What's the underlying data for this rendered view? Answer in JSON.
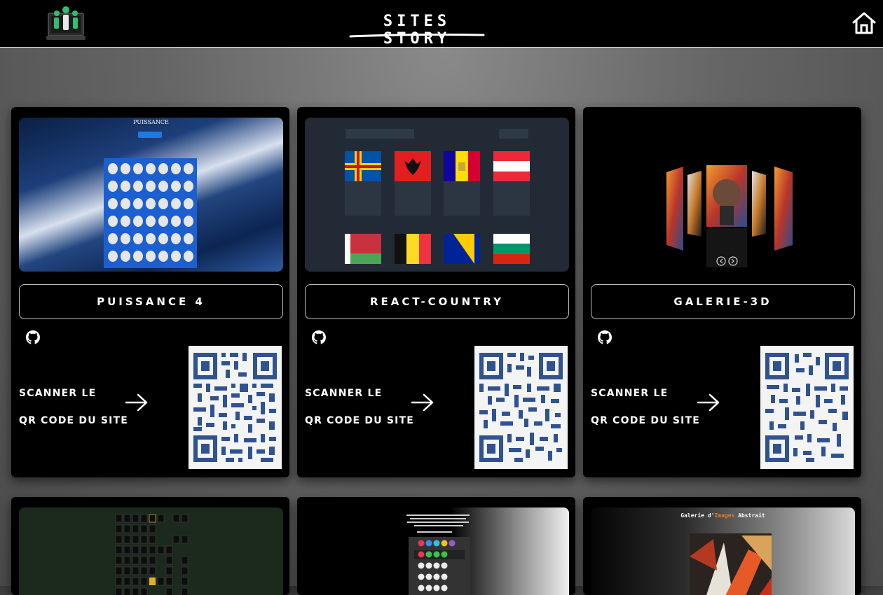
{
  "header": {
    "title": "SITES STORY",
    "logo_icon": "laptop-team-logo",
    "home_icon": "home-icon"
  },
  "projects": [
    {
      "name": "PUISSANCE 4",
      "scan_line1": "SCANNER LE",
      "scan_line2": "QR CODE DU SITE"
    },
    {
      "name": "REACT-COUNTRY",
      "scan_line1": "SCANNER LE",
      "scan_line2": "QR CODE DU SITE"
    },
    {
      "name": "GALERIE-3D",
      "scan_line1": "SCANNER LE",
      "scan_line2": "QR CODE DU SITE"
    },
    {
      "name": "",
      "scan_line1": "",
      "scan_line2": ""
    },
    {
      "name": "",
      "scan_line1": "",
      "scan_line2": ""
    },
    {
      "name": "",
      "scan_line1": "",
      "scan_line2": ""
    }
  ],
  "previews": {
    "puissance": {
      "title": "PUISSANCE"
    },
    "galerie_abstrait": {
      "prefix": "Galerie d'",
      "highlight": "Images",
      "suffix": " Abstrait"
    }
  },
  "colors": {
    "qr": "#2f5390",
    "page_bg": "#6e6e6e",
    "card_bg": "#000000"
  }
}
